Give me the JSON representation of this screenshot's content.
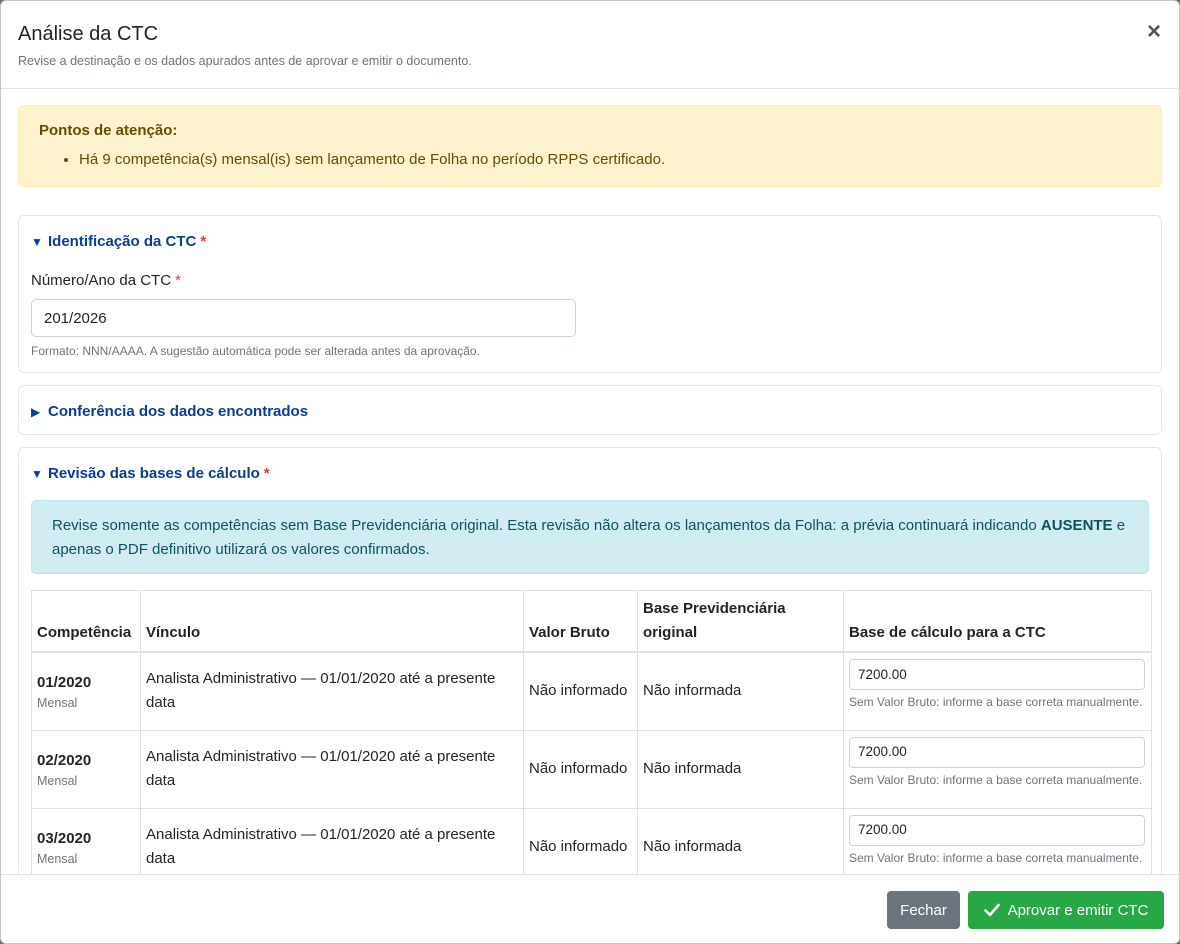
{
  "header": {
    "title": "Análise da CTC",
    "subtitle": "Revise a destinação e os dados apurados antes de aprovar e emitir o documento.",
    "close_glyph": "×"
  },
  "alert": {
    "title": "Pontos de atenção:",
    "items": [
      "Há 9 competência(s) mensal(is) sem lançamento de Folha no período RPPS certificado."
    ]
  },
  "identificacao": {
    "title": "Identificação da CTC",
    "required": "*",
    "field_label": "Número/Ano da CTC",
    "field_value": "201/2026",
    "hint": "Formato: NNN/AAAA. A sugestão automática pode ser alterada antes da aprovação."
  },
  "conferencia": {
    "title": "Conferência dos dados encontrados"
  },
  "revisao": {
    "title": "Revisão das bases de cálculo",
    "required": "*",
    "info_part1": "Revise somente as competências sem Base Previdenciária original. Esta revisão não altera os lançamentos da Folha: a prévia continuará indicando",
    "info_strong": "AUSENTE",
    "info_part2": "e apenas o PDF definitivo utilizará os valores confirmados.",
    "columns": [
      "Competência",
      "Vínculo",
      "Valor Bruto",
      "Base Previdenciária original",
      "Base de cálculo para a CTC"
    ],
    "rows": [
      {
        "competencia": "01/2020",
        "tipo": "Mensal",
        "vinculo": "Analista Administrativo — 01/01/2020 até a presente data",
        "valor_bruto": "Não informado",
        "base_original": "Não informada",
        "base_ctc": "7200.00",
        "hint": "Sem Valor Bruto: informe a base correta manualmente."
      },
      {
        "competencia": "02/2020",
        "tipo": "Mensal",
        "vinculo": "Analista Administrativo — 01/01/2020 até a presente data",
        "valor_bruto": "Não informado",
        "base_original": "Não informada",
        "base_ctc": "7200.00",
        "hint": "Sem Valor Bruto: informe a base correta manualmente."
      },
      {
        "competencia": "03/2020",
        "tipo": "Mensal",
        "vinculo": "Analista Administrativo — 01/01/2020 até a presente data",
        "valor_bruto": "Não informado",
        "base_original": "Não informada",
        "base_ctc": "7200.00",
        "hint": "Sem Valor Bruto: informe a base correta manualmente."
      }
    ]
  },
  "footer": {
    "close_label": "Fechar",
    "approve_label": "Aprovar e emitir CTC"
  },
  "colors": {
    "approve": "#28a745",
    "secondary": "#6c757d",
    "section_title": "#0b3d91",
    "warning_bg": "#fff3cd",
    "info_bg": "#d1ecf1"
  },
  "icons": {
    "expanded": "caret-down-icon",
    "collapsed": "caret-right-icon",
    "approve": "check-icon",
    "close": "close-icon"
  }
}
